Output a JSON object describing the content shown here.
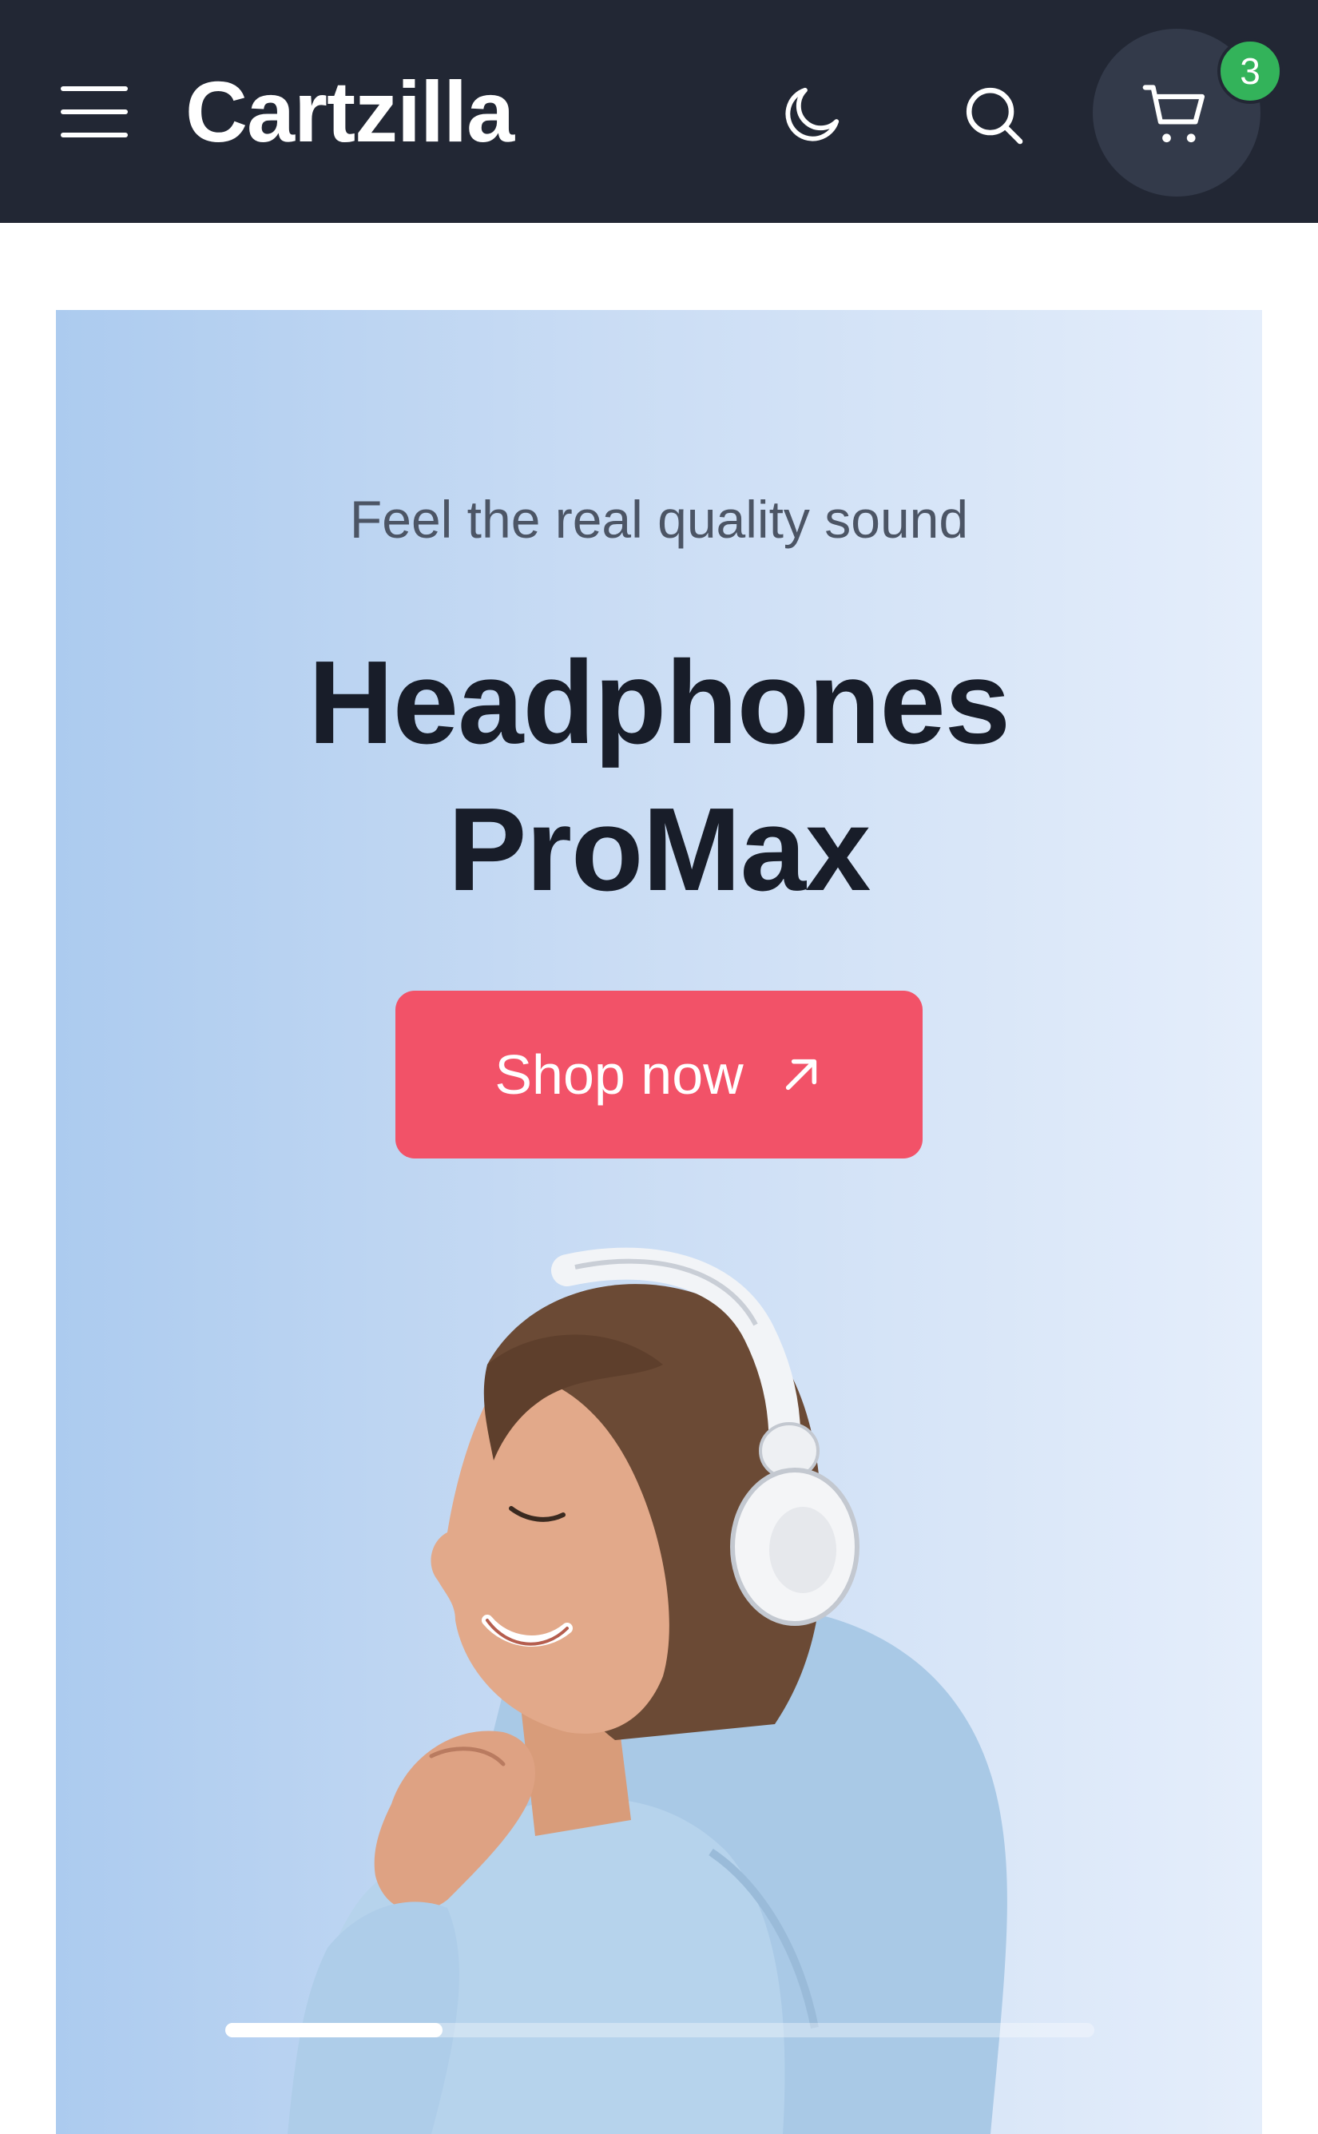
{
  "header": {
    "brand": "Cartzilla",
    "menu_icon": "hamburger-menu-icon",
    "theme_icon": "moon-icon",
    "search_icon": "search-icon",
    "cart_icon": "shopping-cart-icon",
    "cart_count": "3",
    "background_color": "#222734",
    "badge_color": "#33b35a"
  },
  "hero": {
    "subtitle": "Feel the real quality sound",
    "title_line1": "Headphones",
    "title_line2": "ProMax",
    "cta_label": "Shop now",
    "cta_icon": "arrow-up-right-icon",
    "cta_color": "#f25268",
    "image": "woman-wearing-white-headphones",
    "slider_progress": 0.25
  }
}
